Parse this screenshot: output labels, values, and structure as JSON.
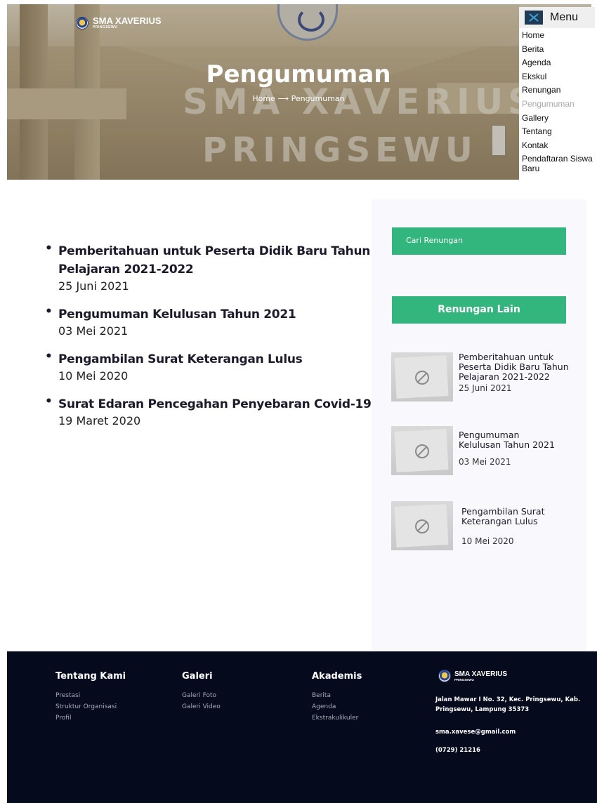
{
  "site": {
    "name": "SMA XAVERIUS",
    "subname": "PRINGSEWU"
  },
  "hero": {
    "title": "Pengumuman",
    "breadcrumb": "Home ⟶ Pengumuman",
    "wall_text_line1": "SMA XAVERIUS",
    "wall_text_line2": "PRINGSEWU"
  },
  "menu": {
    "label": "Menu",
    "items": [
      {
        "label": "Home"
      },
      {
        "label": "Berita"
      },
      {
        "label": "Agenda"
      },
      {
        "label": "Ekskul"
      },
      {
        "label": "Renungan"
      },
      {
        "label": "Pengumuman",
        "active": true
      },
      {
        "label": "Gallery"
      },
      {
        "label": "Tentang"
      },
      {
        "label": "Kontak"
      },
      {
        "label": "Pendaftaran Siswa Baru"
      }
    ]
  },
  "posts": [
    {
      "title": "Pemberitahuan untuk Peserta Didik Baru Tahun Pelajaran 2021-2022",
      "date": "25 Juni 2021"
    },
    {
      "title": "Pengumuman Kelulusan Tahun 2021",
      "date": "03 Mei 2021"
    },
    {
      "title": "Pengambilan Surat Keterangan Lulus",
      "date": "10 Mei 2020"
    },
    {
      "title": "Surat Edaran Pencegahan Penyebaran Covid-19",
      "date": "19 Maret 2020"
    }
  ],
  "sidebar": {
    "search_label": "Cari Renungan",
    "heading": "Renungan Lain",
    "items": [
      {
        "title": "Pemberitahuan untuk Peserta Didik Baru Tahun Pelajaran 2021-2022",
        "date": "25 Juni 2021"
      },
      {
        "title": "Pengumuman Kelulusan Tahun 2021",
        "date": "03 Mei 2021"
      },
      {
        "title": "Pengambilan Surat Keterangan Lulus",
        "date": "10 Mei 2020"
      }
    ]
  },
  "footer": {
    "col1": {
      "heading": "Tentang Kami",
      "links": [
        "Prestasi",
        "Struktur Organisasi",
        "Profil"
      ]
    },
    "col2": {
      "heading": "Galeri",
      "links": [
        "Galeri Foto",
        "Galeri Video"
      ]
    },
    "col3": {
      "heading": "Akademis",
      "links": [
        "Berita",
        "Agenda",
        "Ekstrakulikuler"
      ]
    },
    "address": "Jalan Mawar I No. 32, Kec. Pringsewu, Kab. Pringsewu, Lampung 35373",
    "email": "sma.xavese@gmail.com",
    "phone": "(0729) 21216"
  },
  "colors": {
    "accent": "#33b57e",
    "footer_bg": "#060a1d",
    "sidebar_bg": "#f8f8fd"
  }
}
